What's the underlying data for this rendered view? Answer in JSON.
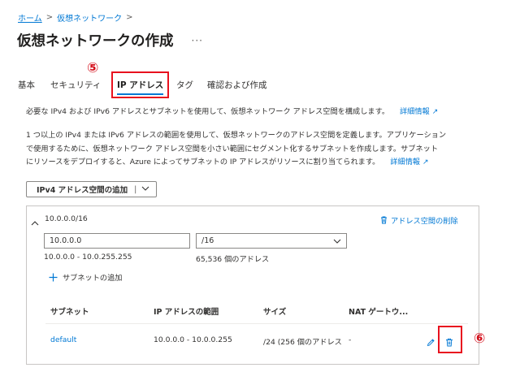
{
  "breadcrumb": {
    "home": "ホーム",
    "current": "仮想ネットワーク",
    "sep": ">"
  },
  "page": {
    "title": "仮想ネットワークの作成",
    "more": "···"
  },
  "tabs": [
    {
      "label": "基本"
    },
    {
      "label": "セキュリティ"
    },
    {
      "label": "IP アドレス"
    },
    {
      "label": "タグ"
    },
    {
      "label": "確認および作成"
    }
  ],
  "markers": {
    "step5": "⑤",
    "step6": "⑥"
  },
  "intro": {
    "text": "必要な IPv4 および IPv6 アドレスとサブネットを使用して、仮想ネットワーク アドレス空間を構成します。",
    "link": "詳細情報"
  },
  "description": {
    "line1": "1 つ以上の IPv4 または IPv6 アドレスの範囲を使用して、仮想ネットワークのアドレス空間を定義します。アプリケーション",
    "line2": "で使用するために、仮想ネットワーク アドレス空間を小さい範囲にセグメント化するサブネットを作成します。サブネット",
    "line3": "にリソースをデプロイすると、Azure によってサブネットの IP アドレスがリソースに割り当てられます。",
    "link": "詳細情報"
  },
  "add_space": {
    "label": "IPv4 アドレス空間の追加",
    "divider": "|"
  },
  "address_space": {
    "name": "10.0.0.0/16",
    "delete_label": "アドレス空間の削除",
    "ip_value": "10.0.0.0",
    "prefix_value": "/16",
    "range": "10.0.0.0 - 10.0.255.255",
    "count": "65,536 個のアドレス",
    "add_subnet": "サブネットの追加"
  },
  "subnet_table": {
    "headers": [
      "サブネット",
      "IP アドレスの範囲",
      "サイズ",
      "NAT ゲートウ..."
    ],
    "rows": [
      {
        "name": "default",
        "range": "10.0.0.0 - 10.0.0.255",
        "size": "/24 (256 個のアドレス",
        "nat": "-"
      }
    ]
  }
}
